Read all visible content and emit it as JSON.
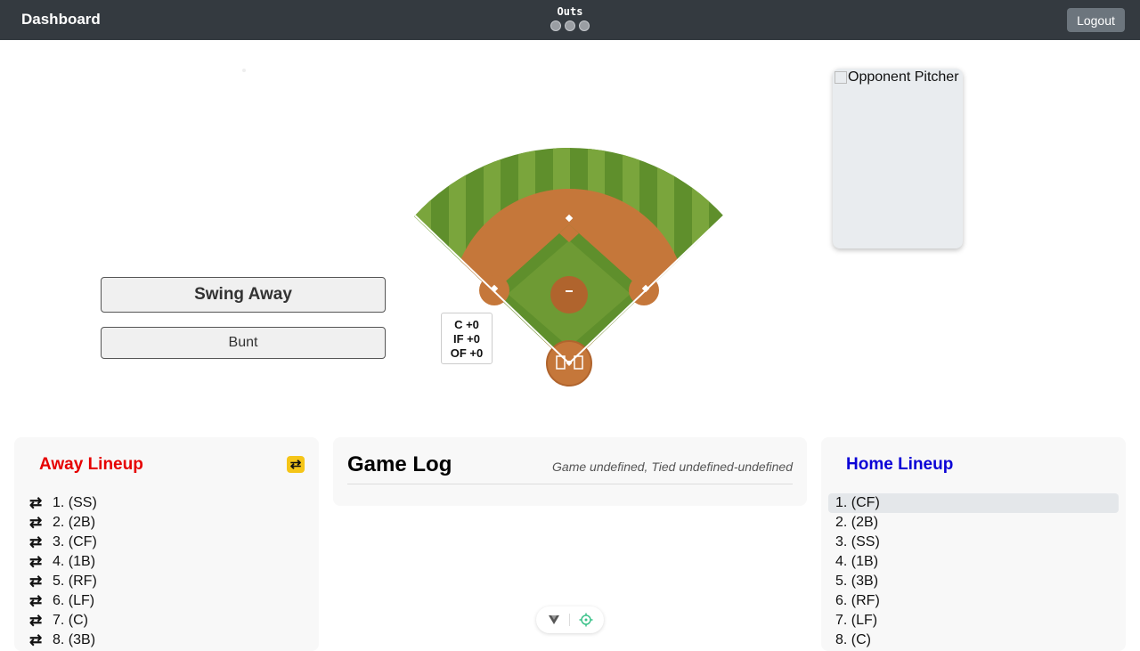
{
  "header": {
    "brand": "Dashboard",
    "outs_label": "Outs",
    "outs_count": 0,
    "outs_max": 3,
    "logout_label": "Logout"
  },
  "actions": {
    "swing_label": "Swing Away",
    "bunt_label": "Bunt"
  },
  "shift": {
    "catcher": "C +0",
    "infield": "IF +0",
    "outfield": "OF +0"
  },
  "pitcher": {
    "alt_text": "Opponent Pitcher"
  },
  "away": {
    "title": "Away Lineup",
    "color": "#e60000",
    "swap_icon": "swap-arrows-icon",
    "players": [
      "1. (SS)",
      "2. (2B)",
      "3. (CF)",
      "4. (1B)",
      "5. (RF)",
      "6. (LF)",
      "7. (C)",
      "8. (3B)"
    ]
  },
  "home": {
    "title": "Home Lineup",
    "color": "#0a00d6",
    "active_index": 0,
    "players": [
      "1. (CF)",
      "2. (2B)",
      "3. (SS)",
      "4. (1B)",
      "5. (3B)",
      "6. (RF)",
      "7. (LF)",
      "8. (C)"
    ]
  },
  "game_log": {
    "title": "Game Log",
    "status": "Game undefined, Tied undefined-undefined"
  },
  "toolbar": {
    "icons": [
      "chevron-down-icon",
      "crosshair-icon"
    ]
  }
}
